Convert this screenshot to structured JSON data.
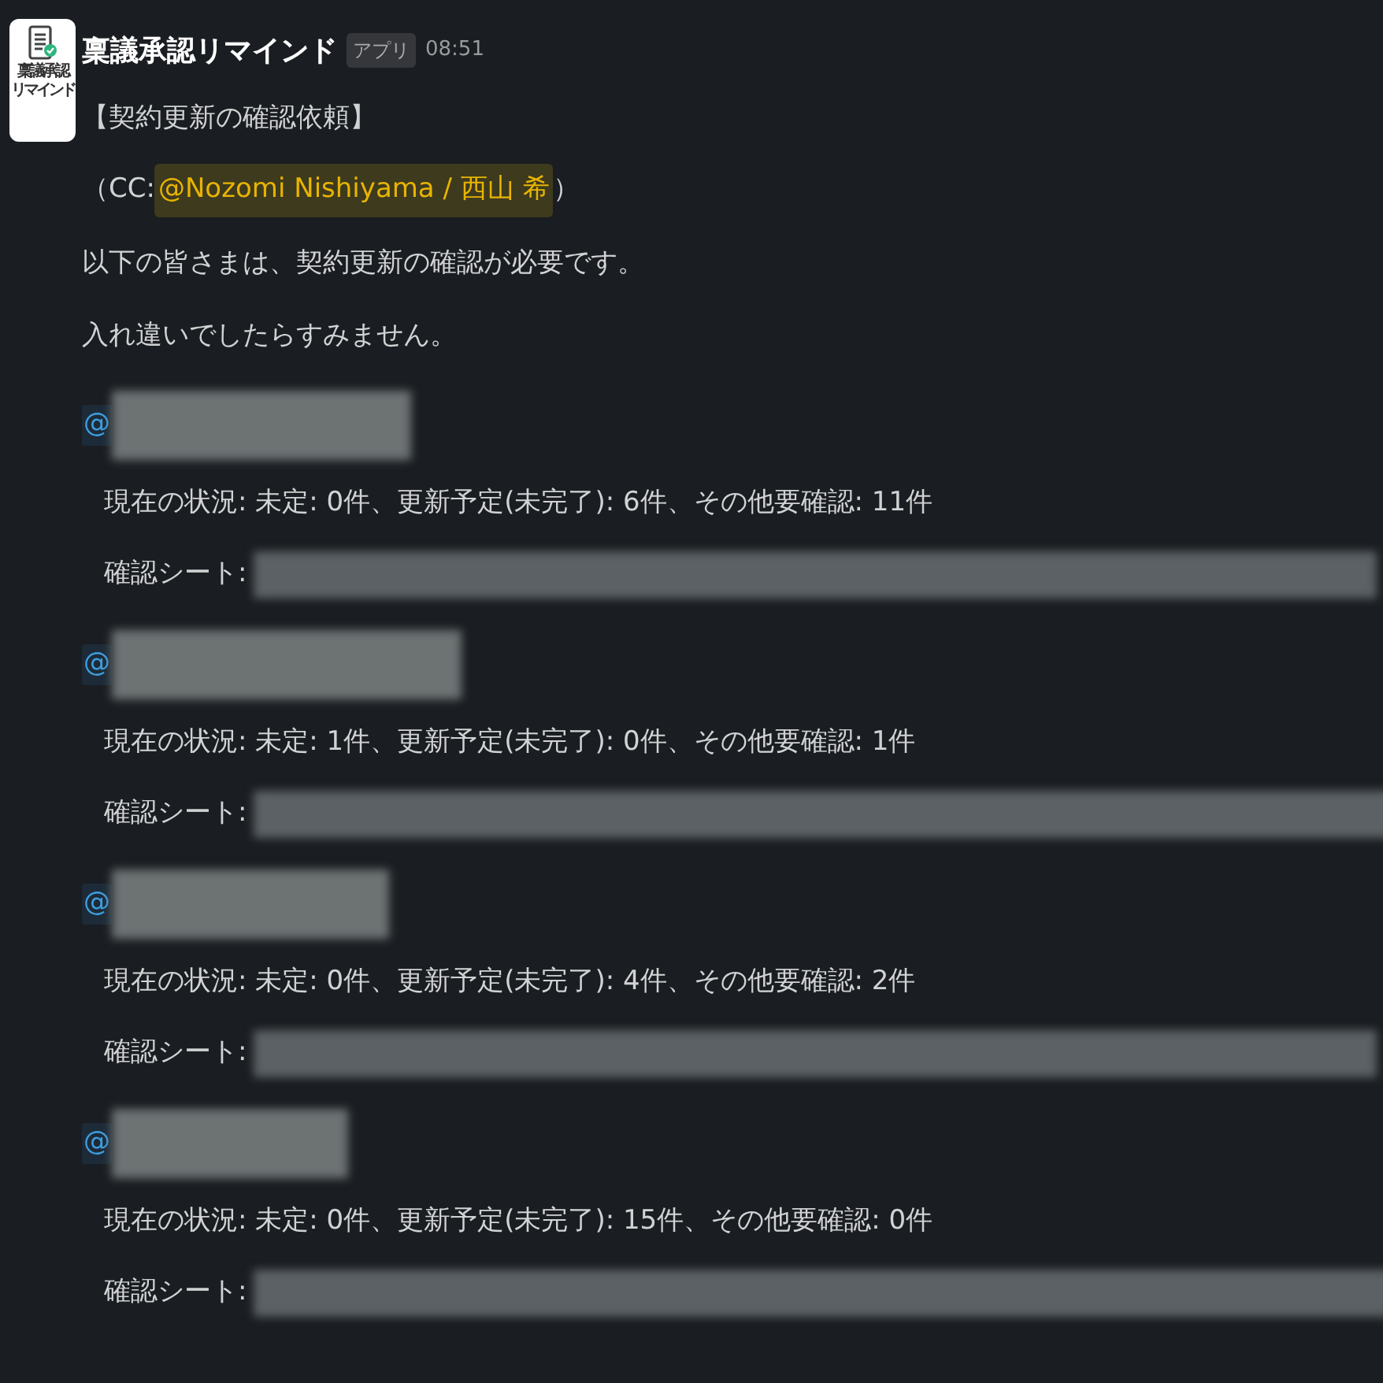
{
  "message": {
    "avatar_text": [
      "稟議承認",
      "リマインド"
    ],
    "sender": "稟議承認リマインド",
    "badge": "アプリ",
    "time": "08:51",
    "title": "【契約更新の確認依頼】",
    "cc": {
      "prefix": "（CC: ",
      "mention": "@Nozomi Nishiyama / 西山 希",
      "suffix": "）"
    },
    "lines": [
      "以下の皆さまは、契約更新の確認が必要です。",
      "入れ違いでしたらすみません。"
    ],
    "entries": [
      {
        "at": "@",
        "status": "現在の状況: 未定: 0件、更新予定(未完了): 6件、その他要確認: 11件",
        "sheet_label": "確認シート:"
      },
      {
        "at": "@",
        "status": "現在の状況: 未定: 1件、更新予定(未完了): 0件、その他要確認: 1件",
        "sheet_label": "確認シート:"
      },
      {
        "at": "@",
        "status": "現在の状況: 未定: 0件、更新予定(未完了): 4件、その他要確認: 2件",
        "sheet_label": "確認シート:"
      },
      {
        "at": "@",
        "status": "現在の状況: 未定: 0件、更新予定(未完了): 15件、その他要確認: 0件",
        "sheet_label": "確認シート:"
      }
    ]
  }
}
